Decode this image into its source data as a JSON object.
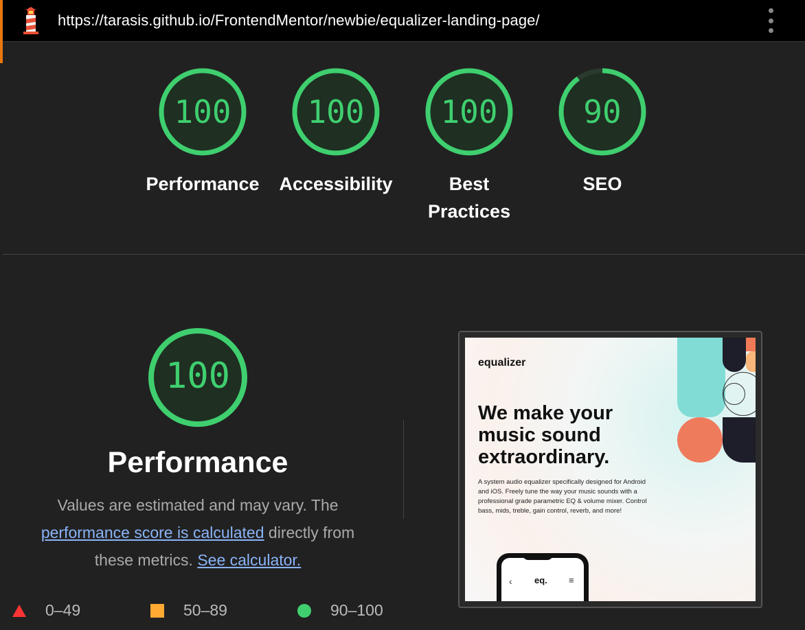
{
  "header": {
    "url": "https://tarasis.github.io/FrontendMentor/newbie/equalizer-landing-page/",
    "logo_icon": "lighthouse-icon",
    "menu_icon": "kebab-menu-icon"
  },
  "categories": [
    {
      "label": "Performance",
      "score": "100",
      "value": 100
    },
    {
      "label": "Accessibility",
      "score": "100",
      "value": 100
    },
    {
      "label": "Best Practices",
      "score": "100",
      "value": 100
    },
    {
      "label": "SEO",
      "score": "90",
      "value": 90
    }
  ],
  "performance": {
    "score": "100",
    "title": "Performance",
    "desc_text1": "Values are estimated and may vary. The",
    "link1": "performance score is calculated",
    "desc_text2": "directly from these metrics.",
    "link2": "See calculator."
  },
  "legend": [
    {
      "range": "0–49",
      "shape": "triangle",
      "color": "#ff3333"
    },
    {
      "range": "50–89",
      "shape": "square",
      "color": "#ffaa33"
    },
    {
      "range": "90–100",
      "shape": "circle",
      "color": "#3fcf6f"
    }
  ],
  "thumbnail": {
    "brand": "equalizer",
    "headline": "We make your music sound extraordinary.",
    "blurb": "A system audio equalizer specifically designed for Android and iOS. Freely tune the way your music sounds with a professional grade parametric EQ & volume mixer. Control bass, mids, treble, gain control, reverb, and more!",
    "phone_label": "eq.",
    "phone_back": "‹",
    "phone_menu": "≡"
  },
  "colors": {
    "pass": "#3fcf6f",
    "background": "#212121",
    "link": "#8ab4f8"
  }
}
